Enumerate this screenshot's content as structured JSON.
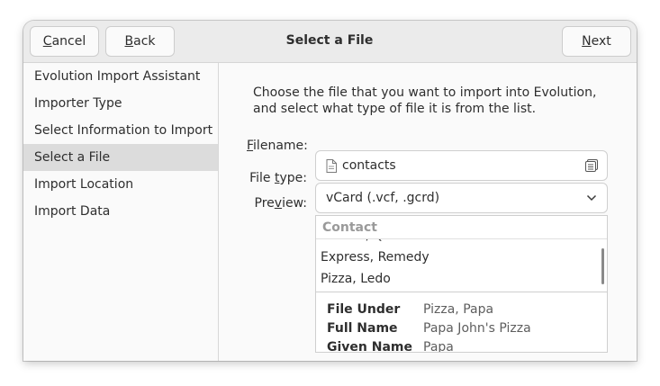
{
  "window": {
    "title": "Select a File"
  },
  "headerbar": {
    "cancel": {
      "mnemonic": "C",
      "rest": "ancel"
    },
    "back": {
      "mnemonic": "B",
      "rest": "ack"
    },
    "next": {
      "mnemonic": "N",
      "rest": "ext"
    }
  },
  "sidebar": {
    "items": [
      {
        "label": "Evolution Import Assistant",
        "active": false
      },
      {
        "label": "Importer Type",
        "active": false
      },
      {
        "label": "Select Information to Import",
        "active": false
      },
      {
        "label": "Select a File",
        "active": true
      },
      {
        "label": "Import Location",
        "active": false
      },
      {
        "label": "Import Data",
        "active": false
      }
    ]
  },
  "main": {
    "intro": "Choose the file that you want to import into Evolution, and select what type of file it is from the list.",
    "filename": {
      "label_mn": "F",
      "label_rest": "ilename:",
      "value": "contacts",
      "icon": "document-icon",
      "browse_icon": "folder-browse-icon"
    },
    "filetype": {
      "label_pre": "File ",
      "label_mn": "t",
      "label_rest": "ype:",
      "value": "vCard (.vcf, .gcrd)",
      "icon": "chevron-down-icon"
    },
    "preview": {
      "label_pre": "Pre",
      "label_mn": "v",
      "label_rest": "iew:",
      "column_header": "Contact",
      "rows": [
        "Sender, Queen",
        "Express, Remedy",
        "Pizza, Ledo"
      ],
      "details": [
        {
          "key": "File Under",
          "value": "Pizza, Papa"
        },
        {
          "key": "Full Name",
          "value": "Papa John's Pizza"
        },
        {
          "key": "Given Name",
          "value": "Papa"
        }
      ]
    }
  }
}
